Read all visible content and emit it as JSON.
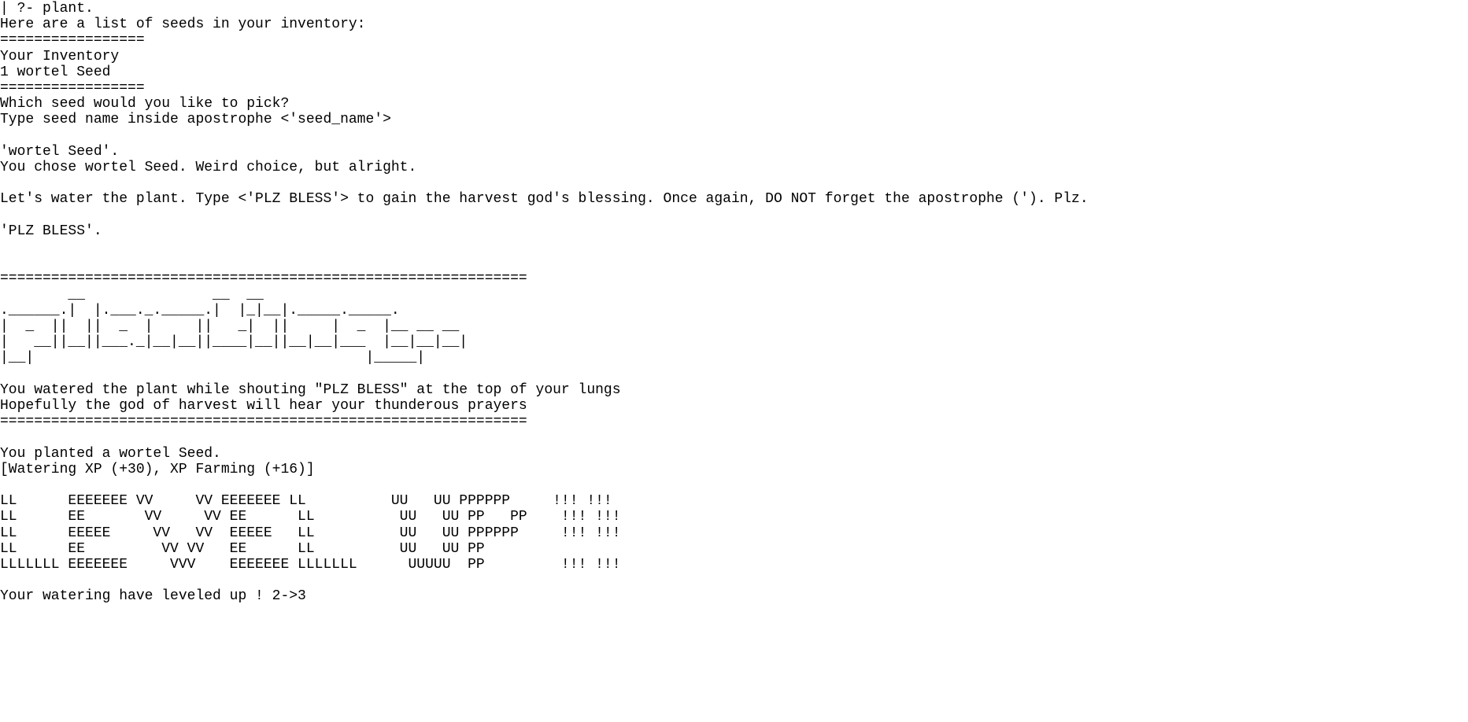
{
  "terminal": {
    "lines": [
      "| ?- plant.",
      "Here are a list of seeds in your inventory:",
      "=================",
      "Your Inventory",
      "1 wortel Seed",
      "=================",
      "Which seed would you like to pick?",
      "Type seed name inside apostrophe <'seed_name'>",
      "",
      "'wortel Seed'.",
      "You chose wortel Seed. Weird choice, but alright.",
      "",
      "Let's water the plant. Type <'PLZ BLESS'> to gain the harvest god's blessing. Once again, DO NOT forget the apostrophe ('). Plz.",
      "",
      "'PLZ BLESS'.",
      "",
      "",
      "==============================================================",
      "        __               __  __",
      ".______.|  |.___._._____.|  |_|__|._____._____.",
      "|  _  ||  ||  _  |     ||   _|  ||     |  _  |__ __ __",
      "|   __||__||___._|__|__||____|__||__|__|___  |__|__|__|",
      "|__|                                       |_____|",
      "",
      "You watered the plant while shouting \"PLZ BLESS\" at the top of your lungs",
      "Hopefully the god of harvest will hear your thunderous prayers",
      "==============================================================",
      "",
      "You planted a wortel Seed.",
      "[Watering XP (+30), XP Farming (+16)]",
      "",
      "LL      EEEEEEE VV     VV EEEEEEE LL          UU   UU PPPPPP     !!! !!!",
      "LL      EE       VV     VV EE      LL          UU   UU PP   PP    !!! !!!",
      "LL      EEEEE     VV   VV  EEEEE   LL          UU   UU PPPPPP     !!! !!!",
      "LL      EE         VV VV   EE      LL          UU   UU PP",
      "LLLLLLL EEEEEEE     VVV    EEEEEEE LLLLLLL      UUUUU  PP         !!! !!!",
      "",
      "Your watering have leveled up ! 2->3"
    ]
  }
}
